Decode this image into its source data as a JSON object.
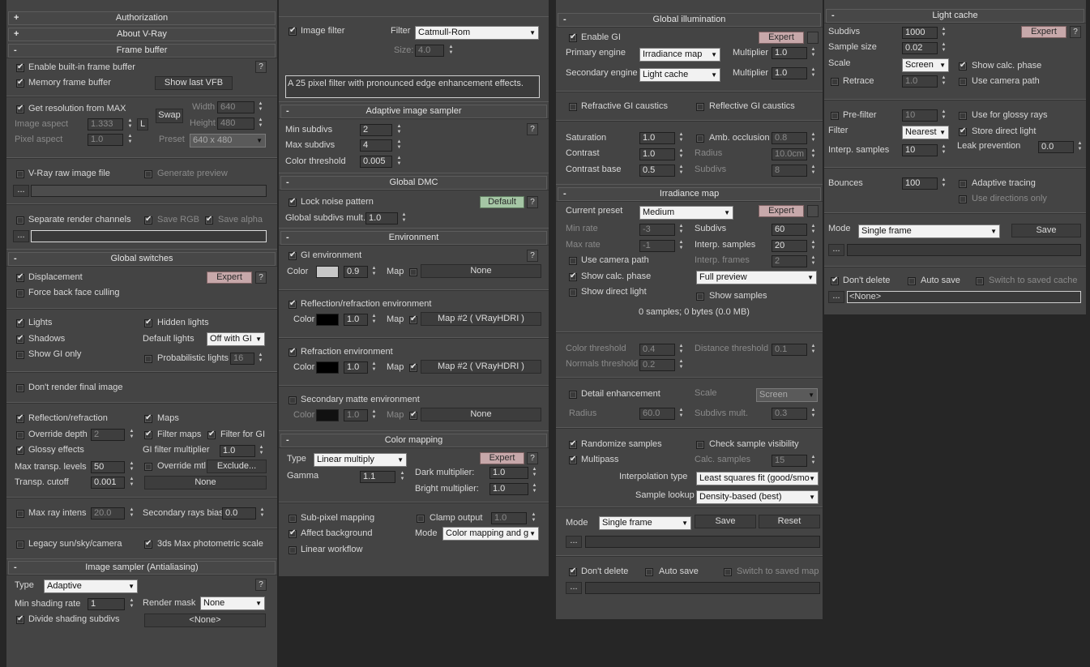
{
  "col1": {
    "authorization": "Authorization",
    "about": "About V-Ray",
    "frame_buffer": "Frame buffer",
    "enable_vfb": "Enable built-in frame buffer",
    "memory_fb": "Memory frame buffer",
    "show_last_vfb": "Show last VFB",
    "get_res": "Get resolution from MAX",
    "width_label": "Width",
    "width_value": "640",
    "height_label": "Height",
    "height_value": "480",
    "swap": "Swap",
    "image_aspect": "Image aspect",
    "image_aspect_value": "1.333",
    "l_button": "L",
    "pixel_aspect": "Pixel aspect",
    "pixel_aspect_value": "1.0",
    "preset_label": "Preset",
    "preset_value": "640 x 480",
    "raw_image": "V-Ray raw image file",
    "gen_preview": "Generate preview",
    "dots": "...",
    "sep_channels": "Separate render channels",
    "save_rgb": "Save RGB",
    "save_alpha": "Save alpha",
    "global_switches": "Global switches",
    "displacement": "Displacement",
    "expert": "Expert",
    "force_back": "Force back face culling",
    "lights": "Lights",
    "hidden_lights": "Hidden lights",
    "shadows": "Shadows",
    "default_lights": "Default lights",
    "default_lights_value": "Off with GI",
    "show_gi_only": "Show GI only",
    "prob_lights": "Probabilistic lights",
    "prob_lights_value": "16",
    "dont_render": "Don't render final image",
    "refl_refr": "Reflection/refraction",
    "maps": "Maps",
    "override_depth": "Override depth",
    "override_depth_value": "2",
    "filter_maps": "Filter maps",
    "filter_gi": "Filter for GI",
    "glossy": "Glossy effects",
    "gi_filter_mult": "GI filter multiplier",
    "gi_filter_mult_value": "1.0",
    "max_transp": "Max transp. levels",
    "max_transp_value": "50",
    "override_mtl": "Override mtl",
    "exclude": "Exclude...",
    "transp_cutoff": "Transp. cutoff",
    "transp_cutoff_value": "0.001",
    "none": "None",
    "max_ray_intens": "Max ray intens",
    "max_ray_intens_value": "20.0",
    "sec_rays_bias": "Secondary rays bias",
    "sec_rays_bias_value": "0.0",
    "legacy_sun": "Legacy sun/sky/camera",
    "photometric": "3ds Max photometric scale",
    "image_sampler": "Image sampler (Antialiasing)",
    "type_label": "Type",
    "type_value": "Adaptive",
    "min_shading": "Min shading rate",
    "min_shading_value": "1",
    "render_mask": "Render mask",
    "render_mask_value": "None",
    "divide_shading": "Divide shading subdivs",
    "none_angle": "<None>",
    "q": "?",
    "minus": "-",
    "plus": "+"
  },
  "col2": {
    "image_filter": "Image filter",
    "filter_label": "Filter",
    "filter_value": "Catmull-Rom",
    "size_label": "Size:",
    "size_value": "4.0",
    "filter_desc": "A 25 pixel filter with pronounced edge enhancement effects.",
    "adaptive": "Adaptive image sampler",
    "min_subdivs": "Min subdivs",
    "min_subdivs_value": "2",
    "max_subdivs": "Max subdivs",
    "max_subdivs_value": "4",
    "color_thresh": "Color threshold",
    "color_thresh_value": "0.005",
    "global_dmc": "Global DMC",
    "lock_noise": "Lock noise pattern",
    "default_btn": "Default",
    "global_subdivs": "Global subdivs mult.",
    "global_subdivs_value": "1.0",
    "environment": "Environment",
    "gi_env": "GI environment",
    "color": "Color",
    "gi_mult": "0.9",
    "map": "Map",
    "none": "None",
    "refl_env": "Reflection/refraction environment",
    "refl_mult": "1.0",
    "refl_map": "Map #2  ( VRayHDRI )",
    "refr_env": "Refraction environment",
    "refr_mult": "1.0",
    "refr_map": "Map #2  ( VRayHDRI )",
    "sec_matte": "Secondary matte environment",
    "sec_mult": "1.0",
    "color_mapping": "Color mapping",
    "type_label": "Type",
    "type_value": "Linear multiply",
    "expert": "Expert",
    "gamma": "Gamma",
    "gamma_value": "1.1",
    "dark_mult": "Dark multiplier:",
    "dark_value": "1.0",
    "bright_mult": "Bright multiplier:",
    "bright_value": "1.0",
    "subpixel": "Sub-pixel mapping",
    "clamp": "Clamp output",
    "clamp_value": "1.0",
    "affect_bg": "Affect background",
    "mode": "Mode",
    "mode_value": "Color mapping and g",
    "linear_wf": "Linear workflow",
    "q": "?",
    "minus": "-"
  },
  "col3": {
    "gi": "Global illumination",
    "enable_gi": "Enable GI",
    "expert": "Expert",
    "primary": "Primary engine",
    "primary_value": "Irradiance map",
    "multiplier": "Multiplier",
    "mult1": "1.0",
    "secondary": "Secondary engine",
    "secondary_value": "Light cache",
    "mult2": "1.0",
    "refr_caustics": "Refractive GI caustics",
    "refl_caustics": "Reflective GI caustics",
    "saturation": "Saturation",
    "saturation_value": "1.0",
    "amb_occ": "Amb. occlusion",
    "amb_occ_value": "0.8",
    "contrast": "Contrast",
    "contrast_value": "1.0",
    "radius": "Radius",
    "radius_value": "10.0cm",
    "contrast_base": "Contrast base",
    "contrast_base_value": "0.5",
    "subdivs": "Subdivs",
    "subdivs_value": "8",
    "irr_map": "Irradiance map",
    "cur_preset": "Current preset",
    "cur_preset_value": "Medium",
    "min_rate": "Min rate",
    "min_rate_value": "-3",
    "subdivs2": "Subdivs",
    "subdivs2_value": "60",
    "max_rate": "Max rate",
    "max_rate_value": "-1",
    "interp_samples": "Interp. samples",
    "interp_samples_value": "20",
    "interp_frames": "Interp. frames",
    "interp_frames_value": "2",
    "use_cam": "Use camera path",
    "show_calc": "Show calc. phase",
    "full_preview": "Full preview",
    "show_direct": "Show direct light",
    "show_samples": "Show samples",
    "samples_info": "0 samples; 0 bytes (0.0 MB)",
    "color_thr": "Color threshold",
    "color_thr_value": "0.4",
    "dist_thr": "Distance threshold",
    "dist_thr_value": "0.1",
    "normals_thr": "Normals threshold",
    "normals_thr_value": "0.2",
    "detail": "Detail enhancement",
    "scale": "Scale",
    "scale_value": "Screen",
    "radius2": "Radius",
    "radius2_value": "60.0",
    "subdivs_mult": "Subdivs mult.",
    "subdivs_mult_value": "0.3",
    "randomize": "Randomize samples",
    "check_vis": "Check sample visibility",
    "multipass": "Multipass",
    "calc_samples": "Calc. samples",
    "calc_samples_value": "15",
    "interp_type": "Interpolation type",
    "interp_type_value": "Least squares fit (good/smo",
    "sample_lookup": "Sample lookup",
    "sample_lookup_value": "Density-based (best)",
    "mode": "Mode",
    "mode_value": "Single frame",
    "save": "Save",
    "reset": "Reset",
    "dots": "...",
    "dont_delete": "Don't delete",
    "auto_save": "Auto save",
    "switch_saved": "Switch to saved map",
    "minus": "-"
  },
  "col4": {
    "light_cache": "Light cache",
    "subdivs": "Subdivs",
    "subdivs_value": "1000",
    "expert": "Expert",
    "sample_size": "Sample size",
    "sample_size_value": "0.02",
    "scale": "Scale",
    "scale_value": "Screen",
    "show_calc": "Show calc. phase",
    "retrace": "Retrace",
    "retrace_value": "1.0",
    "use_cam": "Use camera path",
    "prefilter": "Pre-filter",
    "prefilter_value": "10",
    "use_glossy": "Use for glossy rays",
    "filter": "Filter",
    "filter_value": "Nearest",
    "store_direct": "Store direct light",
    "interp_samples": "Interp. samples",
    "interp_samples_value": "10",
    "leak": "Leak prevention",
    "leak_value": "0.0",
    "bounces": "Bounces",
    "bounces_value": "100",
    "adaptive": "Adaptive tracing",
    "use_dirs": "Use directions only",
    "mode": "Mode",
    "mode_value": "Single frame",
    "save": "Save",
    "dots": "...",
    "dont_delete": "Don't delete",
    "auto_save": "Auto save",
    "switch_saved": "Switch to saved cache",
    "none_angle": "<None>",
    "q": "?",
    "minus": "-"
  }
}
